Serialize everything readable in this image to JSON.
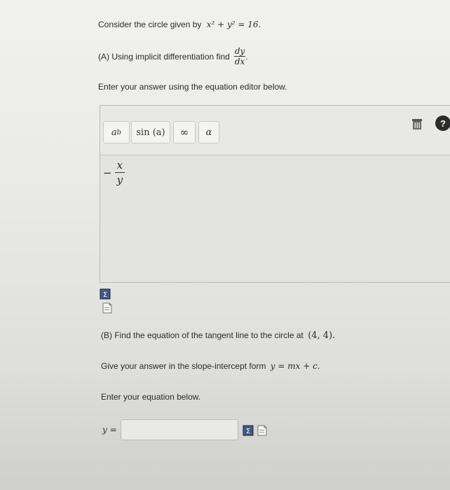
{
  "question": {
    "intro_prefix": "Consider the circle given by",
    "intro_equation": "x² + y² = 16.",
    "part_a_prefix": "(A) Using implicit differentiation find",
    "part_a_frac_num": "dy",
    "part_a_frac_den": "dx",
    "part_a_suffix": ".",
    "instruction_a": "Enter your answer using the equation editor below.",
    "part_b_prefix": "(B) Find the equation of the tangent line to the circle at",
    "part_b_point": "(4, 4).",
    "part_b_form_prefix": "Give your answer in the slope-intercept form",
    "part_b_form_eq": "y = mx + c.",
    "instruction_b": "Enter your equation below.",
    "answer_b_label": "y ="
  },
  "editor": {
    "toolbar": {
      "superscript_label": "a",
      "superscript_exp": "b",
      "sin_label": "sin (a)",
      "infinity_label": "∞",
      "alpha_label": "α"
    },
    "answer": {
      "sign": "−",
      "numerator": "x",
      "denominator": "y"
    }
  },
  "icons": {
    "trash": "trash-icon",
    "help": "help-icon",
    "preview": "preview-icon",
    "page": "page-icon"
  },
  "colors": {
    "help_bg": "#2b2b2b",
    "button_bg": "#f4f4f2"
  }
}
